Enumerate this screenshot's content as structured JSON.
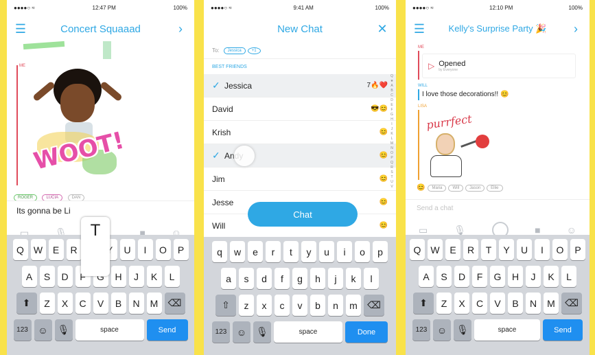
{
  "colors": {
    "accent": "#2fa8e4",
    "separator": "#f9e24a",
    "keyboard": "#d3d6db",
    "send": "#1f8ff0"
  },
  "phone1": {
    "status": {
      "carrier": "●●●●○ ≈",
      "time": "12:47 PM",
      "battery": "100%"
    },
    "title": "Concert Squaaad",
    "sender_label": "ME",
    "sticker_text": "WOOT!",
    "chips": [
      "ROGER",
      "LUCIA",
      "DAN"
    ],
    "message": "Its gonna be Li",
    "key_popup": "T",
    "keyboard": {
      "row1": [
        "Q",
        "W",
        "E",
        "R",
        "",
        "Y",
        "U",
        "I",
        "O",
        "P"
      ],
      "row2": [
        "A",
        "S",
        "D",
        "F",
        "G",
        "H",
        "J",
        "K",
        "L"
      ],
      "row3": [
        "Z",
        "X",
        "C",
        "V",
        "B",
        "N",
        "M"
      ],
      "num": "123",
      "space": "space",
      "send": "Send"
    }
  },
  "phone2": {
    "status": {
      "carrier": "●●●●○ ≈",
      "time": "9:41 AM",
      "battery": "100%"
    },
    "title": "New Chat",
    "to_label": "To:",
    "to_chips": [
      "Jessica",
      "+1"
    ],
    "section": "BEST FRIENDS",
    "contacts": [
      {
        "name": "Jessica",
        "checked": true,
        "emoji": "7🔥❤️"
      },
      {
        "name": "David",
        "checked": false,
        "emoji": "😎😊"
      },
      {
        "name": "Krish",
        "checked": false,
        "emoji": "😊"
      },
      {
        "name": "Andy",
        "checked": true,
        "emoji": "😊"
      },
      {
        "name": "Jim",
        "checked": false,
        "emoji": "😊"
      },
      {
        "name": "Jesse",
        "checked": false,
        "emoji": "😊"
      },
      {
        "name": "Will",
        "checked": false,
        "emoji": "😊"
      }
    ],
    "index": [
      "Q",
      "★",
      "A",
      "B",
      "C",
      "D",
      "E",
      "F",
      "G",
      "H",
      "I",
      "J",
      "K",
      "L",
      "M",
      "N",
      "O",
      "P",
      "Q",
      "R",
      "S",
      "T",
      "U",
      "V"
    ],
    "chat_button": "Chat",
    "keyboard": {
      "row1": [
        "q",
        "w",
        "e",
        "r",
        "t",
        "y",
        "u",
        "i",
        "o",
        "p"
      ],
      "row2": [
        "a",
        "s",
        "d",
        "f",
        "g",
        "h",
        "j",
        "k",
        "l"
      ],
      "row3": [
        "z",
        "x",
        "c",
        "v",
        "b",
        "n",
        "m"
      ],
      "num": "123",
      "space": "space",
      "done": "Done"
    }
  },
  "phone3": {
    "status": {
      "carrier": "●●●●○ ≈",
      "time": "12:10 PM",
      "battery": "100%"
    },
    "title": "Kelly's Surprise Party 🎉",
    "me_label": "ME",
    "opened_label": "Opened",
    "opened_sub": "by Everyone",
    "will_label": "WILL",
    "will_message": "I love those decorations!! 😊",
    "lisa_label": "LISA",
    "sticker_text": "purrfect",
    "chips": [
      "Maria",
      "Will",
      "Jason",
      "Ellie"
    ],
    "input_placeholder": "Send a chat",
    "keyboard": {
      "row1": [
        "Q",
        "W",
        "E",
        "R",
        "T",
        "Y",
        "U",
        "I",
        "O",
        "P"
      ],
      "row2": [
        "A",
        "S",
        "D",
        "F",
        "G",
        "H",
        "J",
        "K",
        "L"
      ],
      "row3": [
        "Z",
        "X",
        "C",
        "V",
        "B",
        "N",
        "M"
      ],
      "num": "123",
      "space": "space",
      "send": "Send"
    }
  }
}
